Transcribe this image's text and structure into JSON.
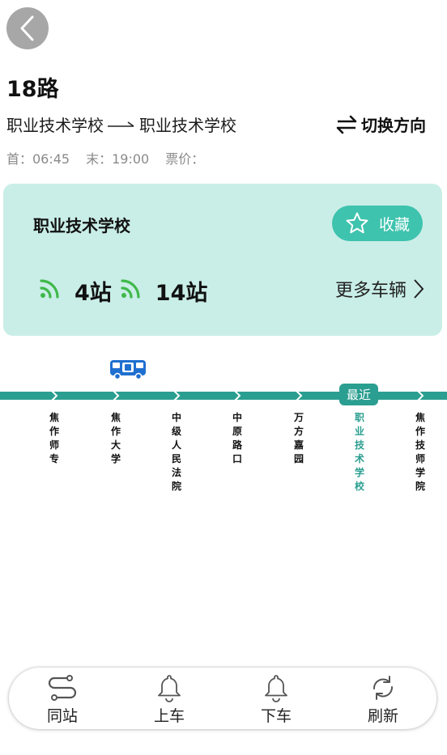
{
  "header": {
    "route_name": "18路",
    "from_station": "职业技术学校",
    "to_station": "职业技术学校",
    "switch_label": "切换方向",
    "first_bus": "首：06:45",
    "last_bus": "末：19:00",
    "fare": "票价："
  },
  "card": {
    "station_name": "职业技术学校",
    "favorite_label": "收藏",
    "buses": [
      {
        "count": "4站"
      },
      {
        "count": "14站"
      }
    ],
    "more_label": "更多车辆"
  },
  "line": {
    "nearest_label": "最近",
    "stations": [
      {
        "name": "焦作师专"
      },
      {
        "name": "焦作大学"
      },
      {
        "name": "中级人民法院"
      },
      {
        "name": "中原路口"
      },
      {
        "name": "万方嘉园"
      },
      {
        "name": "职业技术学校"
      },
      {
        "name": "焦作技师学院"
      }
    ]
  },
  "bottom_nav": {
    "tabs": [
      {
        "label": "同站",
        "icon": "route-icon"
      },
      {
        "label": "上车",
        "icon": "bell-icon"
      },
      {
        "label": "下车",
        "icon": "bell-icon"
      },
      {
        "label": "刷新",
        "icon": "refresh-icon"
      }
    ]
  },
  "colors": {
    "accent": "#2a9e90",
    "card_bg": "#c9eee7",
    "favorite_bg": "#3ec3ae",
    "signal": "#3fb84a",
    "bus_icon": "#1f6fd0"
  }
}
